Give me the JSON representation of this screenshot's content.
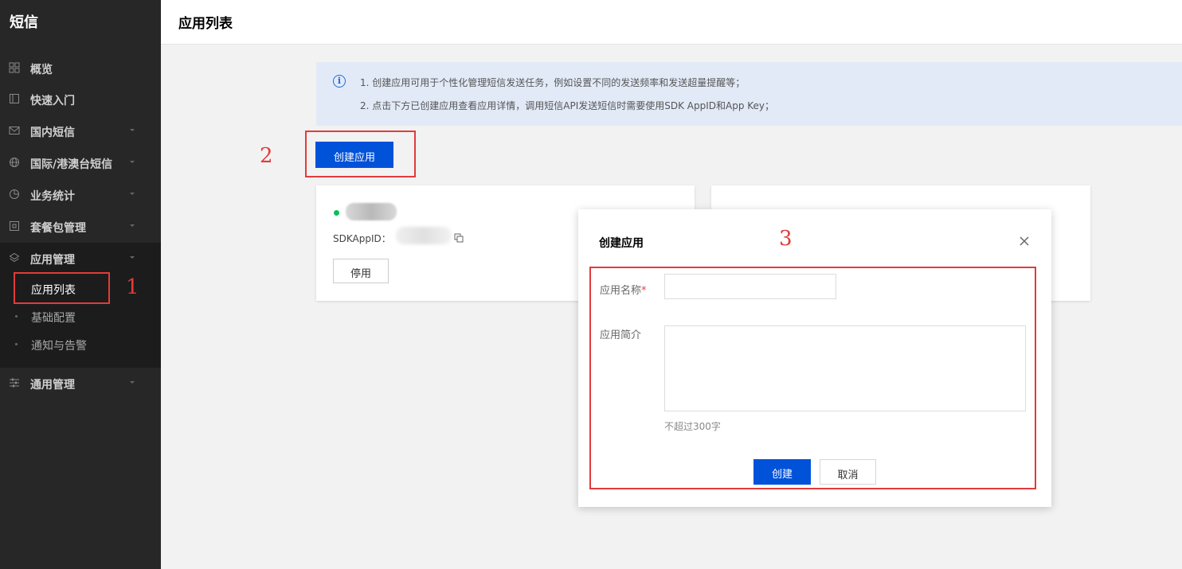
{
  "sidebar": {
    "title": "短信",
    "items": [
      {
        "label": "概览",
        "icon": "grid-icon"
      },
      {
        "label": "快速入门",
        "icon": "book-icon"
      },
      {
        "label": "国内短信",
        "icon": "mail-icon"
      },
      {
        "label": "国际/港澳台短信",
        "icon": "globe-icon"
      },
      {
        "label": "业务统计",
        "icon": "pie-chart-icon"
      },
      {
        "label": "套餐包管理",
        "icon": "package-icon"
      },
      {
        "label": "应用管理",
        "icon": "layers-icon"
      },
      {
        "label": "通用管理",
        "icon": "sliders-icon"
      }
    ],
    "sub_items": [
      "应用列表",
      "基础配置",
      "通知与告警"
    ]
  },
  "header": {
    "title": "应用列表"
  },
  "info": {
    "line1": "1. 创建应用可用于个性化管理短信发送任务，例如设置不同的发送频率和发送超量提醒等；",
    "line2": "2. 点击下方已创建应用查看应用详情，调用短信API发送短信时需要使用SDK AppID和App Key；"
  },
  "toolbar": {
    "create_label": "创建应用"
  },
  "app_card": {
    "sdk_label": "SDKAppID：",
    "stop_label": "停用"
  },
  "annotations": {
    "a1": "1",
    "a2": "2",
    "a3": "3"
  },
  "modal": {
    "title": "创建应用",
    "name_label": "应用名称",
    "required_mark": "*",
    "desc_label": "应用简介",
    "hint": "不超过300字",
    "ok_label": "创建",
    "cancel_label": "取消"
  },
  "colors": {
    "accent": "#0052d9",
    "annotation": "#e23b3b",
    "sidebar": "#272727",
    "success": "#0abf5b"
  }
}
